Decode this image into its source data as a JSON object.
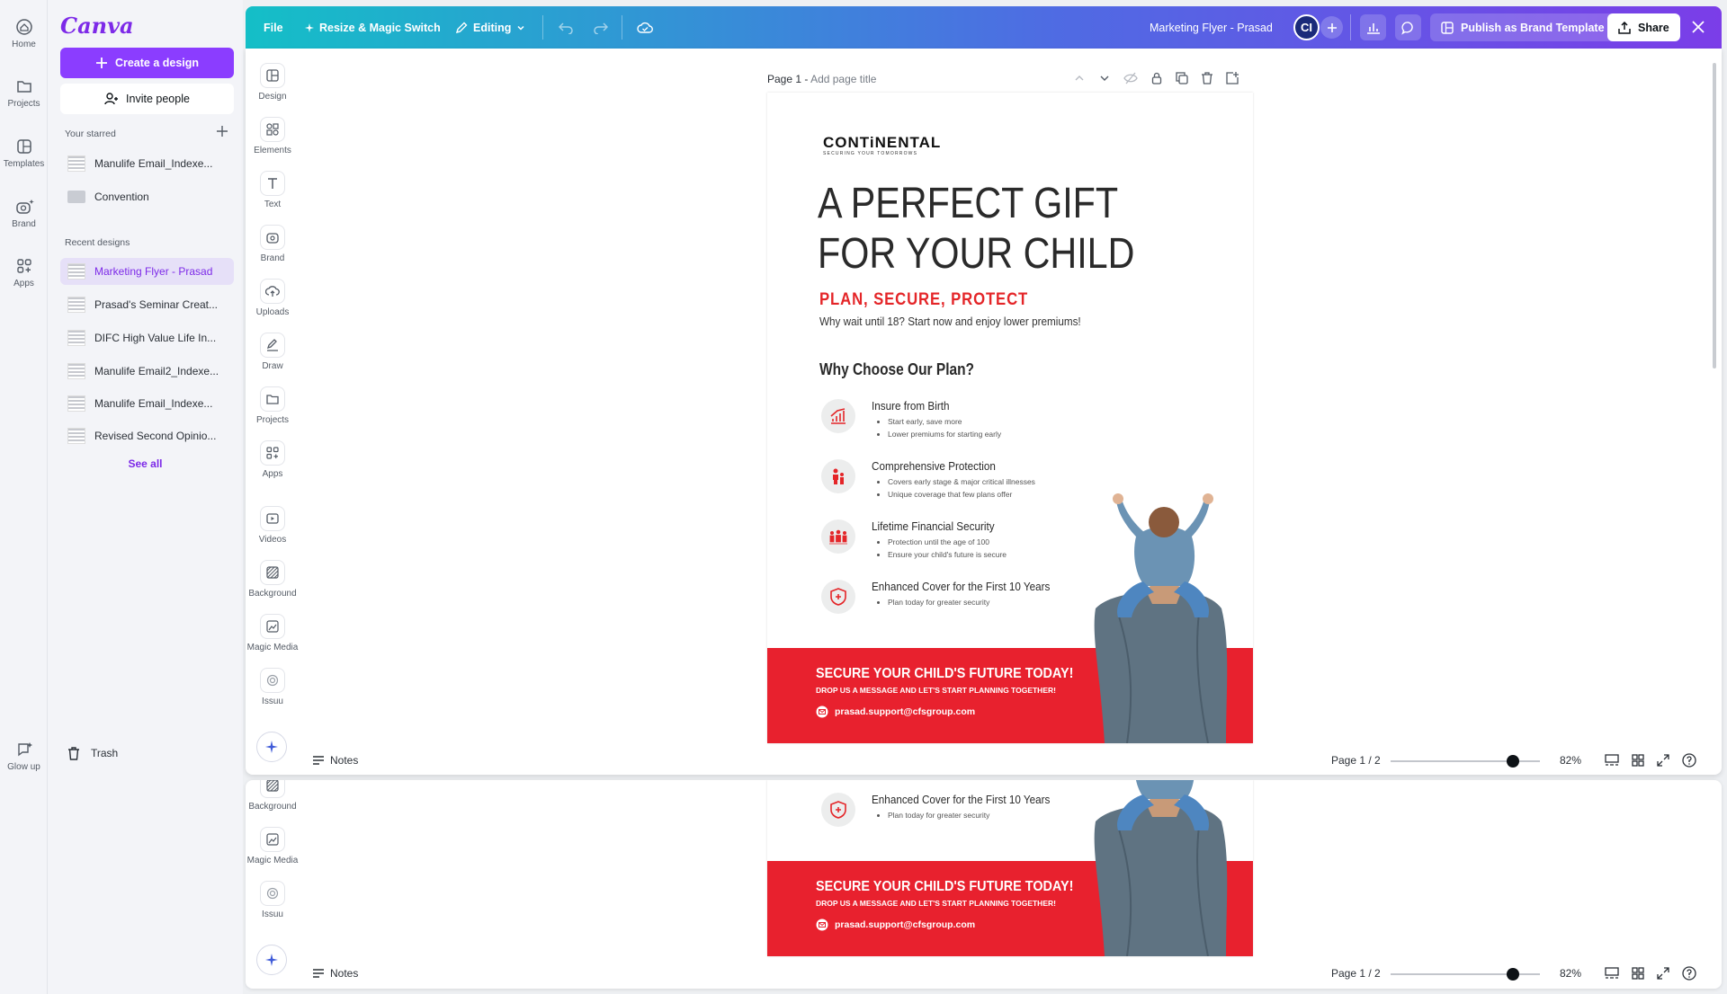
{
  "rail": {
    "items": [
      {
        "label": "Home",
        "icon": "home-icon"
      },
      {
        "label": "Projects",
        "icon": "folder-icon"
      },
      {
        "label": "Templates",
        "icon": "templates-icon"
      },
      {
        "label": "Brand",
        "icon": "brand-icon"
      },
      {
        "label": "Apps",
        "icon": "apps-icon"
      }
    ],
    "glow_up": "Glow up"
  },
  "sidebar": {
    "logo": "Canva",
    "create_label": "Create a design",
    "invite_label": "Invite people",
    "starred_heading": "Your starred",
    "starred": [
      {
        "label": "Manulife Email_Indexe..."
      },
      {
        "label": "Convention"
      }
    ],
    "recent_heading": "Recent designs",
    "recent": [
      {
        "label": "Marketing Flyer - Prasad"
      },
      {
        "label": "Prasad's Seminar Creat..."
      },
      {
        "label": "DIFC High Value Life In..."
      },
      {
        "label": "Manulife Email2_Indexe..."
      },
      {
        "label": "Manulife Email_Indexe..."
      },
      {
        "label": "Revised Second Opinio..."
      }
    ],
    "see_all": "See all",
    "trash": "Trash"
  },
  "topbar": {
    "file": "File",
    "resize": "Resize & Magic Switch",
    "editing": "Editing",
    "doc_title": "Marketing Flyer - Prasad",
    "avatar": "CI",
    "publish": "Publish as Brand Template",
    "share": "Share",
    "gradient": [
      "#14bfc7",
      "#4f6be3",
      "#7b3de8"
    ]
  },
  "tools": [
    {
      "label": "Design",
      "icon": "design-icon"
    },
    {
      "label": "Elements",
      "icon": "elements-icon"
    },
    {
      "label": "Text",
      "icon": "text-icon"
    },
    {
      "label": "Brand",
      "icon": "brand-icon"
    },
    {
      "label": "Uploads",
      "icon": "uploads-icon"
    },
    {
      "label": "Draw",
      "icon": "draw-icon"
    },
    {
      "label": "Projects",
      "icon": "folder-icon"
    },
    {
      "label": "Apps",
      "icon": "apps-icon"
    },
    {
      "label": "Videos",
      "icon": "videos-icon"
    },
    {
      "label": "Background",
      "icon": "background-icon"
    },
    {
      "label": "Magic Media",
      "icon": "magic-media-icon"
    },
    {
      "label": "Issuu",
      "icon": "issuu-icon"
    }
  ],
  "page_header": {
    "page": "Page 1",
    "sep": " - ",
    "add_title": "Add page title"
  },
  "footer": {
    "notes": "Notes",
    "page_indicator": "Page 1 / 2",
    "zoom": "82%",
    "zoom_fraction": 0.82
  },
  "flyer": {
    "logo": "CONTiNENTAL",
    "logo_tagline": "SECURING YOUR TOMORROWS",
    "headline_1": "A PERFECT GIFT",
    "headline_2": "FOR YOUR CHILD",
    "subhead": "PLAN, SECURE, PROTECT",
    "subtext": "Why wait until 18? Start now and enjoy lower premiums!",
    "why": "Why Choose Our Plan?",
    "features": [
      {
        "title": "Insure from Birth",
        "bullets": [
          "Start early, save more",
          "Lower premiums for starting early"
        ]
      },
      {
        "title": "Comprehensive Protection",
        "bullets": [
          "Covers early stage & major critical illnesses",
          "Unique coverage that few plans offer"
        ]
      },
      {
        "title": "Lifetime Financial Security",
        "bullets": [
          "Protection until the age of 100",
          "Ensure your child's future is secure"
        ]
      },
      {
        "title": "Enhanced Cover for the First 10 Years",
        "bullets": [
          "Plan today for greater security"
        ]
      }
    ],
    "cta_1": "SECURE YOUR CHILD'S FUTURE TODAY!",
    "cta_2": "DROP US A MESSAGE AND LET'S START PLANNING TOGETHER!",
    "email": "prasad.support@cfsgroup.com",
    "red": "#e8212e"
  }
}
